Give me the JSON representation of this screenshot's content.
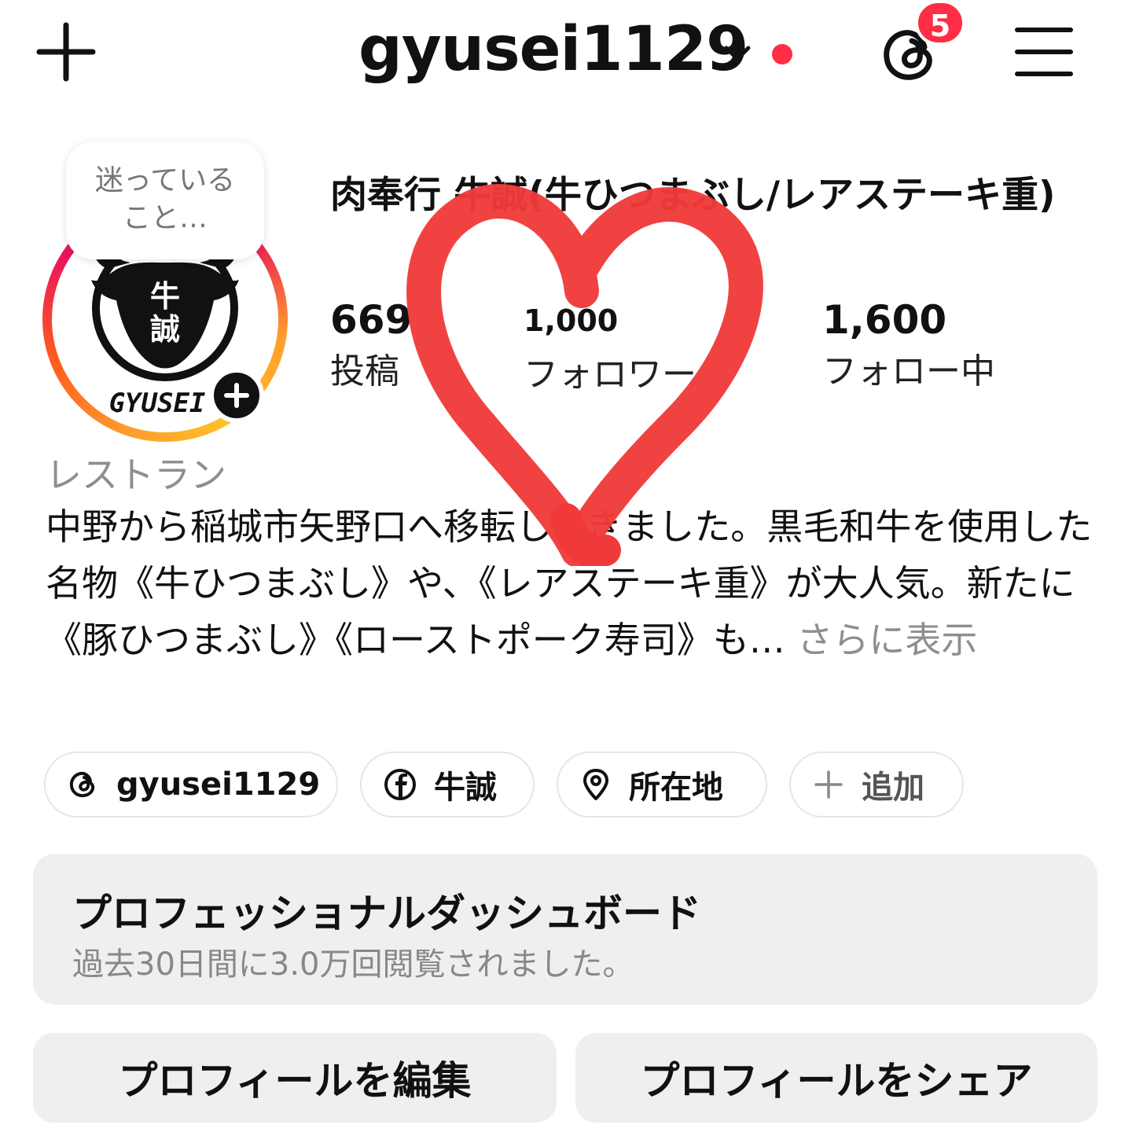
{
  "header": {
    "username": "gyusei1129",
    "notification_count": "5"
  },
  "note": {
    "line1": "迷っている",
    "line2": "こと…"
  },
  "profile": {
    "display_name": "肉奉行 牛誠(牛ひつまぶし/レアステーキ重)",
    "logo_text": "GYUSEI",
    "logo_kanji": "牛誠",
    "stats": [
      {
        "value": "669",
        "label": "投稿"
      },
      {
        "value": "1,000",
        "label": "フォロワー"
      },
      {
        "value": "1,600",
        "label": "フォロー中"
      }
    ],
    "category": "レストラン",
    "bio": "中野から稲城市矢野口へ移転してきました。黒毛和牛を使用した名物《牛ひつまぶし》や、《レアステーキ重》が大人気。新たに《豚ひつまぶし》《ローストポーク寿司》も…",
    "more": "さらに表示"
  },
  "links": [
    {
      "icon": "threads-icon",
      "label": "gyusei1129"
    },
    {
      "icon": "facebook-icon",
      "label": "牛誠"
    },
    {
      "icon": "location-pin-icon",
      "label": "所在地"
    },
    {
      "icon": "plus-icon",
      "label": "追加"
    }
  ],
  "dashboard": {
    "title": "プロフェッショナルダッシュボード",
    "subtitle": "過去30日間に3.0万回閲覧されました。"
  },
  "buttons": {
    "edit": "プロフィールを編集",
    "share": "プロフィールをシェア"
  },
  "colors": {
    "accent_red": "#ff2d45",
    "heart_red": "#f03a3a",
    "chip_border": "#e6e6e6",
    "panel_bg": "#efeff2"
  }
}
